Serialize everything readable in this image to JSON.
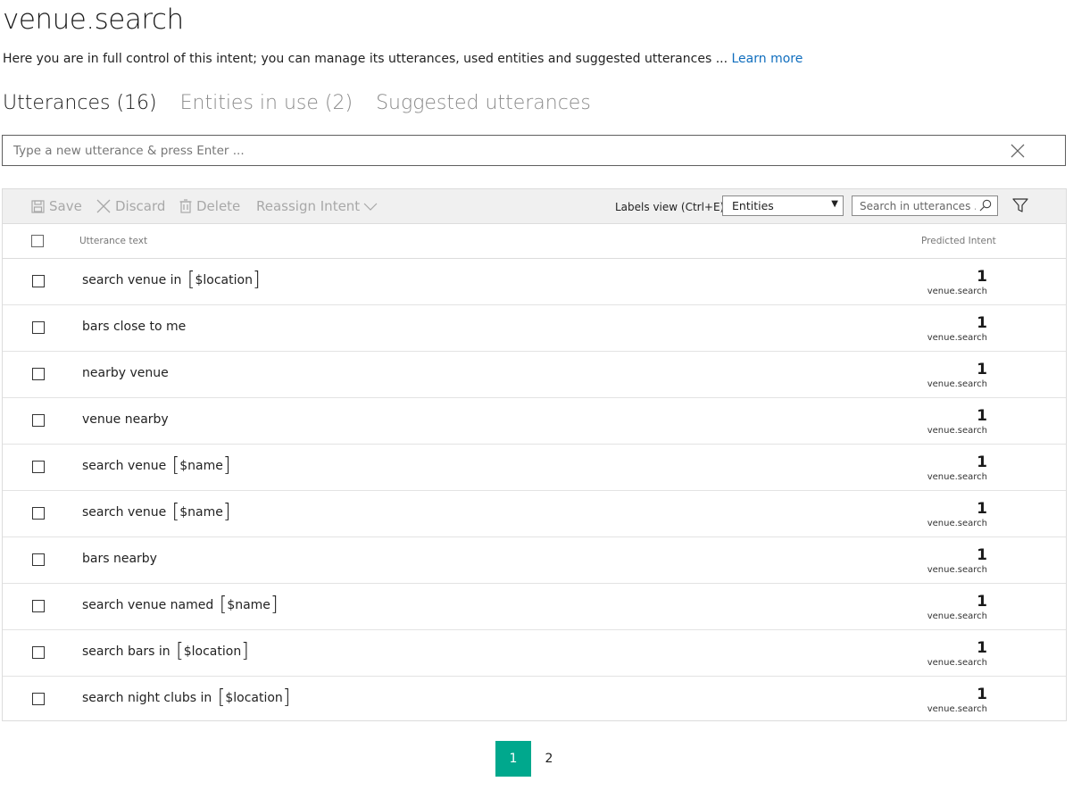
{
  "header": {
    "title": "venue.search",
    "subtitle": "Here you are in full control of this intent; you can manage its utterances, used entities and suggested utterances ...",
    "learn_more": "Learn more"
  },
  "tabs": [
    {
      "label": "Utterances (16)",
      "active": true
    },
    {
      "label": "Entities in use (2)",
      "active": false
    },
    {
      "label": "Suggested utterances",
      "active": false
    }
  ],
  "utterance_input": {
    "placeholder": "Type a new utterance & press Enter ..."
  },
  "toolbar": {
    "save_label": "Save",
    "discard_label": "Discard",
    "delete_label": "Delete",
    "reassign_label": "Reassign Intent",
    "labels_view_label": "Labels view (Ctrl+E):",
    "labels_view_value": "Entities",
    "search_placeholder": "Search in utterances ..."
  },
  "table": {
    "col_text": "Utterance text",
    "col_pred": "Predicted Intent",
    "rows": [
      {
        "text": "search venue in",
        "entity": "$location",
        "score": "1",
        "intent": "venue.search"
      },
      {
        "text": "bars close to me",
        "entity": "",
        "score": "1",
        "intent": "venue.search"
      },
      {
        "text": "nearby venue",
        "entity": "",
        "score": "1",
        "intent": "venue.search"
      },
      {
        "text": "venue nearby",
        "entity": "",
        "score": "1",
        "intent": "venue.search"
      },
      {
        "text": "search venue",
        "entity": "$name",
        "score": "1",
        "intent": "venue.search"
      },
      {
        "text": "search venue",
        "entity": "$name",
        "score": "1",
        "intent": "venue.search"
      },
      {
        "text": "bars nearby",
        "entity": "",
        "score": "1",
        "intent": "venue.search"
      },
      {
        "text": "search venue named",
        "entity": "$name",
        "score": "1",
        "intent": "venue.search"
      },
      {
        "text": "search bars in",
        "entity": "$location",
        "score": "1",
        "intent": "venue.search"
      },
      {
        "text": "search night clubs in",
        "entity": "$location",
        "score": "1",
        "intent": "venue.search"
      }
    ]
  },
  "pagination": {
    "pages": [
      "1",
      "2"
    ],
    "current": "1"
  },
  "colors": {
    "accent": "#00a88d",
    "link": "#106ebe",
    "disabled": "#a8a8a8"
  }
}
